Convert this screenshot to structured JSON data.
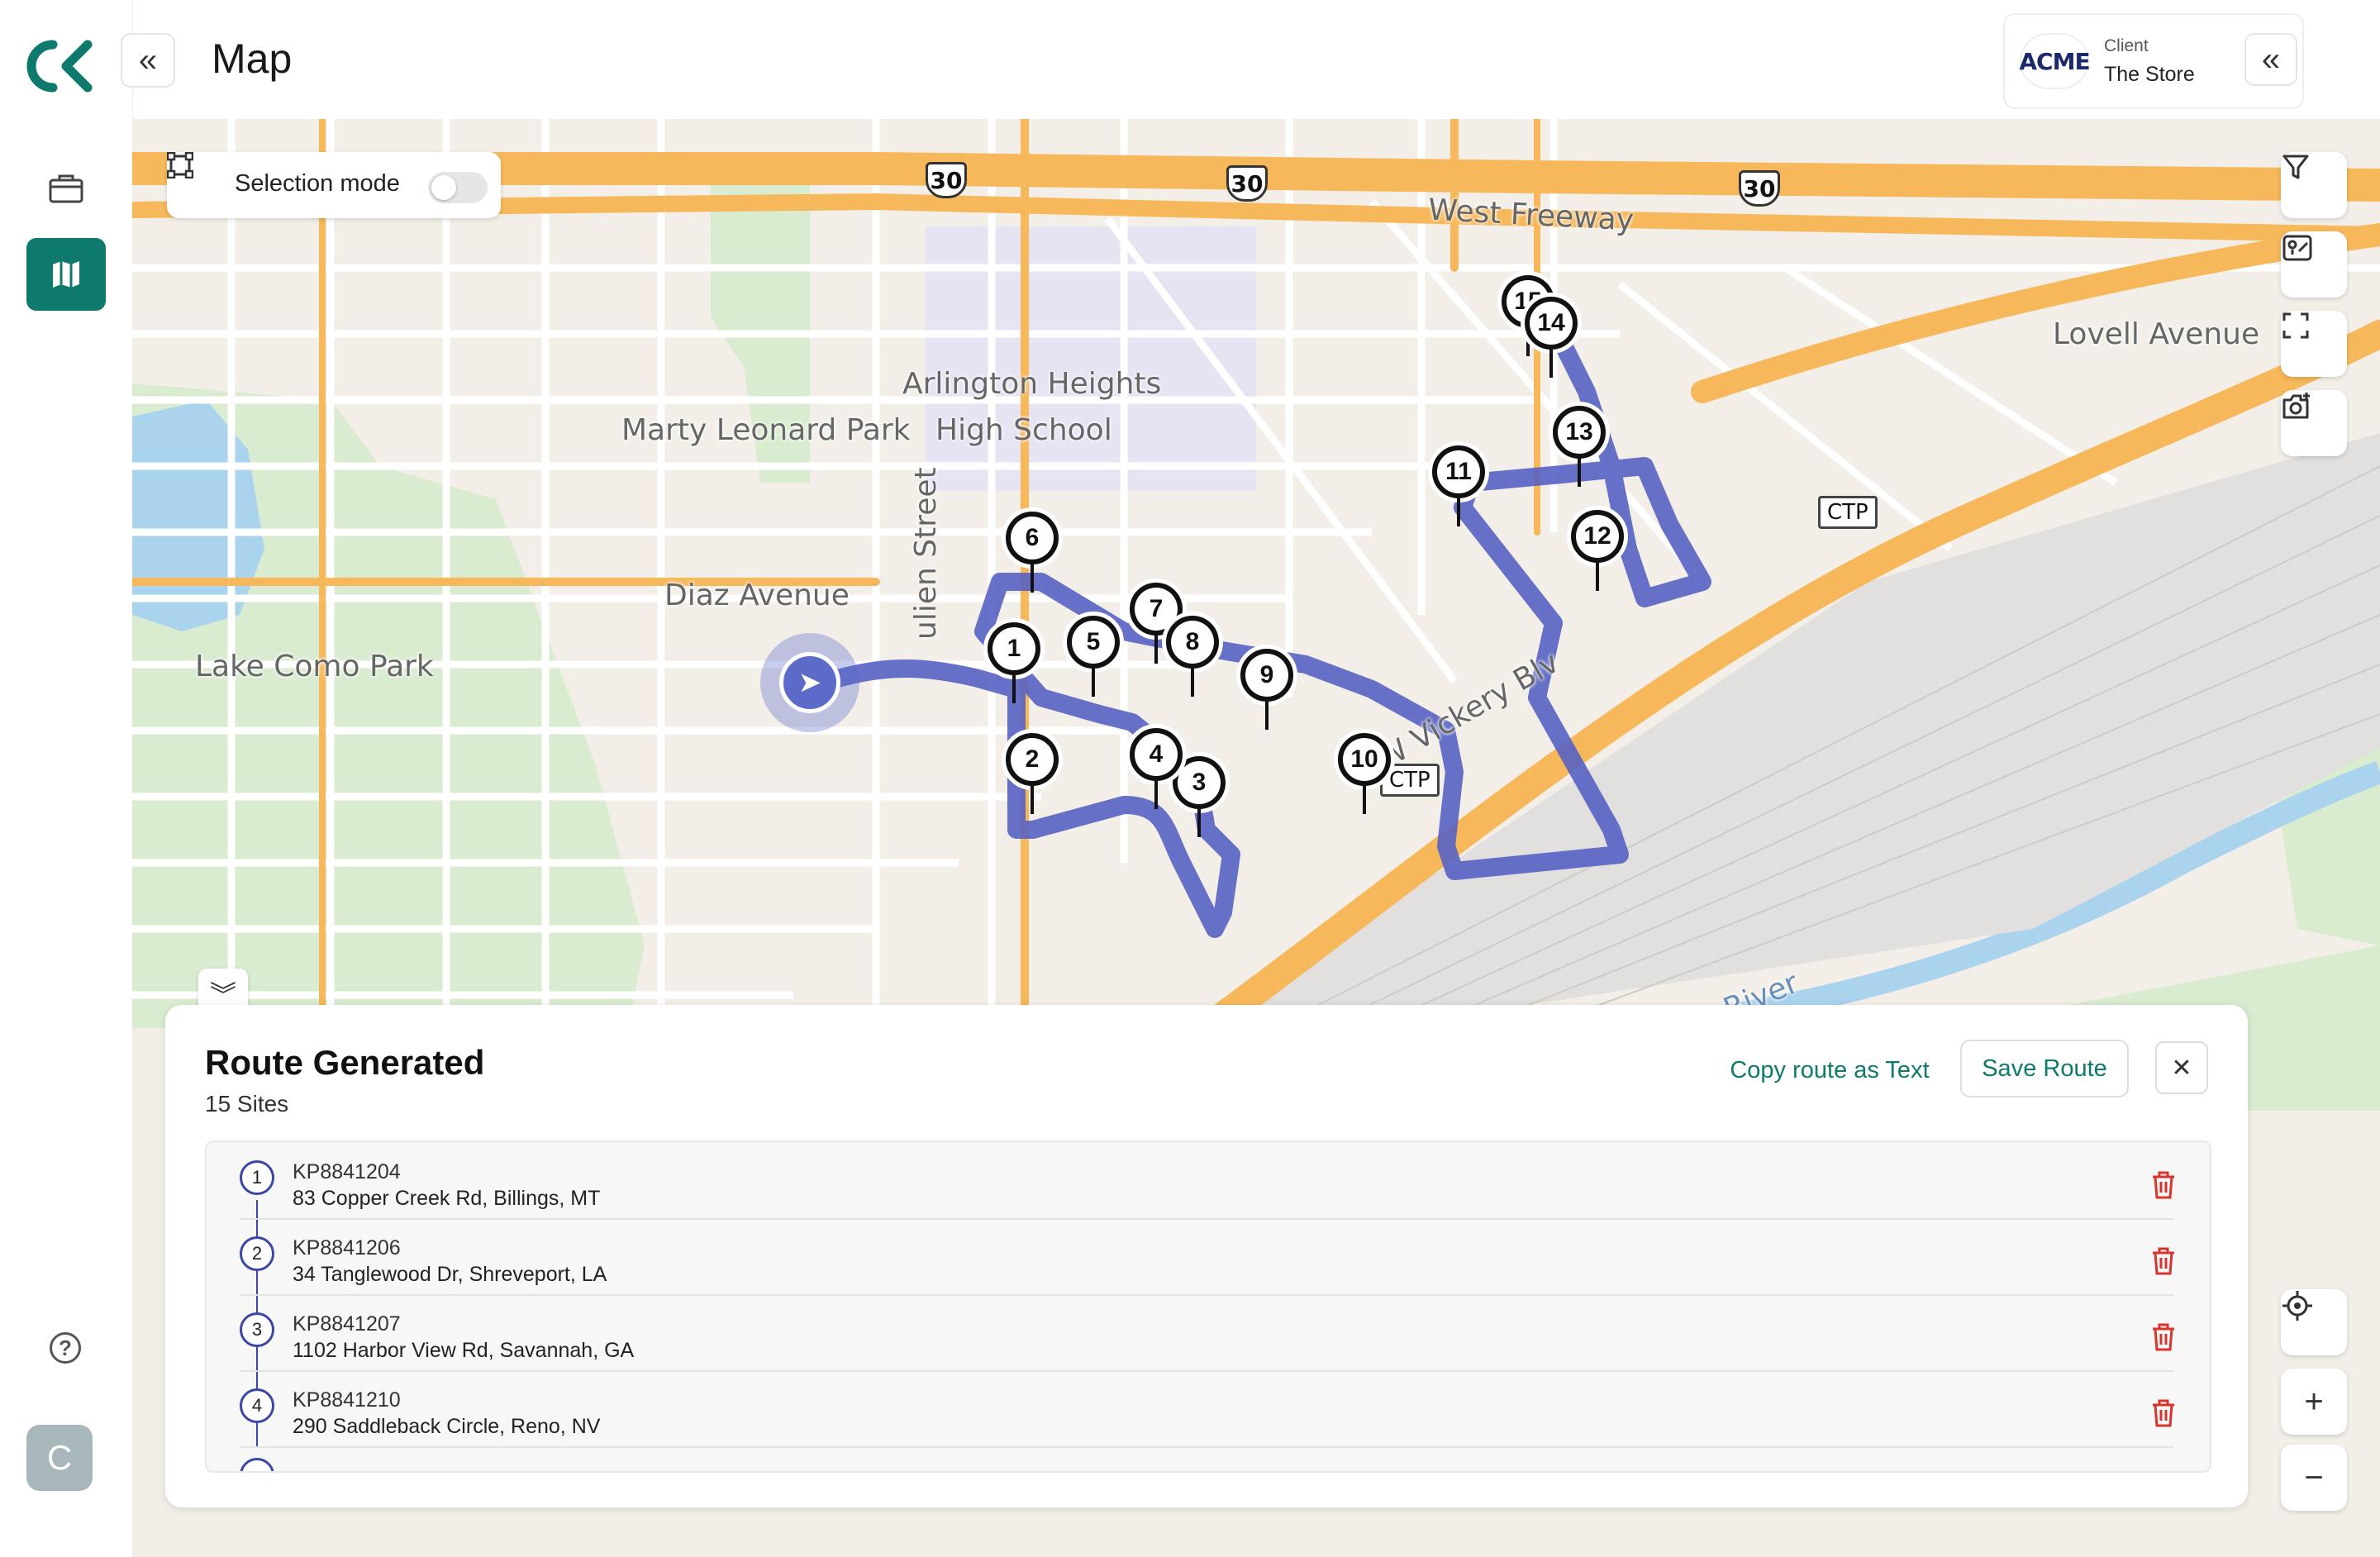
{
  "header": {
    "title": "Map"
  },
  "client": {
    "logo_text": "ACME",
    "label": "Client",
    "name": "The Store"
  },
  "user": {
    "initial": "C"
  },
  "map": {
    "selection_mode_label": "Selection mode",
    "labels": {
      "west_freeway": "West Freeway",
      "lovell": "Lovell Avenue",
      "arlington": "Arlington Heights",
      "high_school": "High School",
      "marty": "Marty Leonard Park",
      "diaz": "Diaz Avenue",
      "lake_como": "Lake Como Park",
      "julien": "ulien Street",
      "vickery": "W Vickery Blv",
      "river": "River",
      "ctp": "CTP"
    },
    "shields": [
      "30",
      "30",
      "30"
    ],
    "stop_numbers": [
      "1",
      "2",
      "3",
      "4",
      "5",
      "6",
      "7",
      "8",
      "9",
      "10",
      "11",
      "12",
      "13",
      "14",
      "15"
    ],
    "route_color": "#5662c3"
  },
  "route": {
    "title": "Route Generated",
    "subtitle": "15 Sites",
    "copy_label": "Copy route as Text",
    "save_label": "Save Route",
    "close_label": "✕",
    "sites": [
      {
        "num": "1",
        "id": "KP8841204",
        "address": "83 Copper Creek Rd, Billings, MT"
      },
      {
        "num": "2",
        "id": "KP8841206",
        "address": "34 Tanglewood Dr, Shreveport, LA"
      },
      {
        "num": "3",
        "id": "KP8841207",
        "address": "1102 Harbor View Rd, Savannah, GA"
      },
      {
        "num": "4",
        "id": "KP8841210",
        "address": "290 Saddleback Circle, Reno, NV"
      }
    ]
  }
}
